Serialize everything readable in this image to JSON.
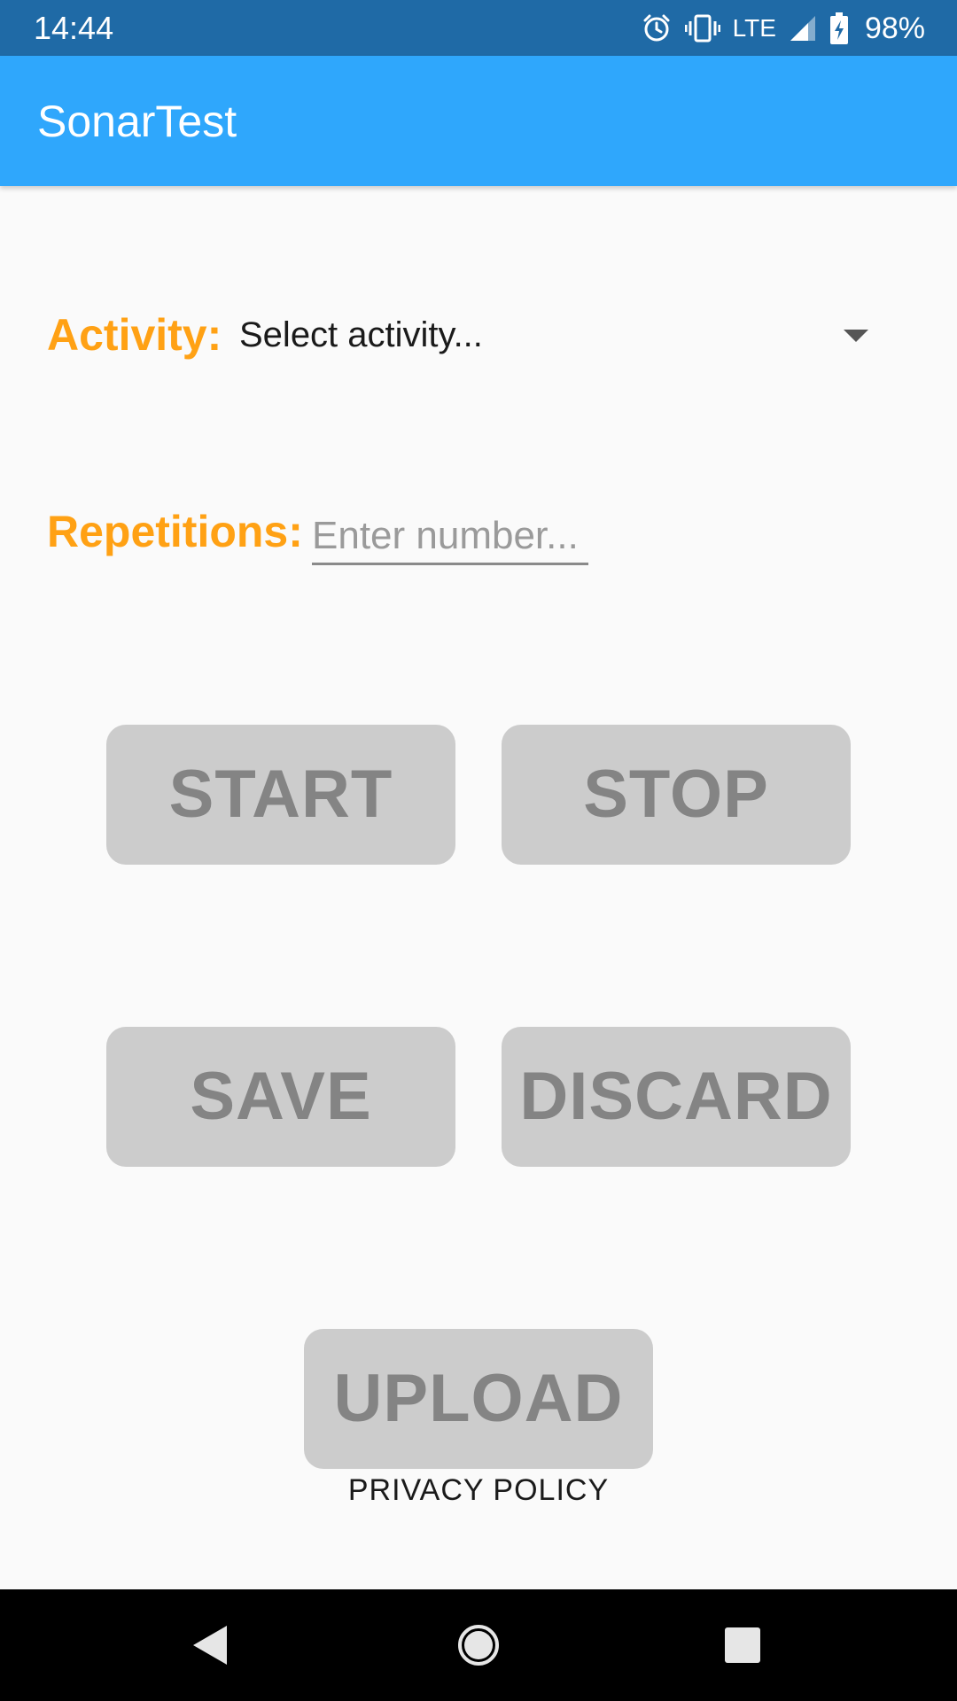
{
  "status_bar": {
    "time": "14:44",
    "network": "LTE",
    "battery": "98%",
    "icons": [
      "alarm-icon",
      "vibrate-icon",
      "signal-icon",
      "battery-charging-icon"
    ]
  },
  "app_bar": {
    "title": "SonarTest"
  },
  "form": {
    "activity_label": "Activity:",
    "activity_value": "Select activity...",
    "repetitions_label": "Repetitions:",
    "repetitions_value": "",
    "repetitions_placeholder": "Enter number..."
  },
  "buttons": {
    "start": "START",
    "stop": "STOP",
    "save": "SAVE",
    "discard": "DISCARD",
    "upload": "UPLOAD"
  },
  "links": {
    "privacy_policy": "PRIVACY POLICY"
  },
  "nav_bar": {
    "icons": [
      "back-icon",
      "home-icon",
      "recents-icon"
    ]
  },
  "colors": {
    "status_bar": "#1f6aa6",
    "app_bar": "#2fa7fc",
    "label_accent": "#ffa114",
    "button_bg": "#cccccc",
    "button_text": "#848484",
    "background": "#fafafa",
    "nav_bar": "#000000"
  }
}
